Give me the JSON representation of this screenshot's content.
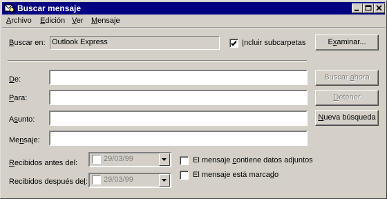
{
  "window": {
    "title": "Buscar mensaje"
  },
  "menu": [
    {
      "pre": "",
      "key": "A",
      "post": "rchivo"
    },
    {
      "pre": "",
      "key": "E",
      "post": "dición"
    },
    {
      "pre": "",
      "key": "V",
      "post": "er"
    },
    {
      "pre": "",
      "key": "M",
      "post": "ensaje"
    }
  ],
  "search_in": {
    "label_pre": "",
    "label_key": "B",
    "label_post": "uscar en:",
    "value": "Outlook Express",
    "subfolders": {
      "pre": "",
      "key": "I",
      "post": "ncluir subcarpetas",
      "checked": true
    },
    "browse": {
      "pre": "E",
      "key": "x",
      "post": "aminar..."
    }
  },
  "fields": {
    "from": {
      "pre": "",
      "key": "D",
      "post": "e:",
      "value": ""
    },
    "to": {
      "pre": "",
      "key": "P",
      "post": "ara:",
      "value": ""
    },
    "subject": {
      "pre": "A",
      "key": "s",
      "post": "unto:",
      "value": ""
    },
    "message": {
      "pre": "Me",
      "key": "n",
      "post": "saje:",
      "value": ""
    }
  },
  "buttons": {
    "find_now": {
      "pre": "Buscar ",
      "key": "a",
      "post": "hora",
      "enabled": false
    },
    "stop": {
      "pre": "",
      "key": "D",
      "post": "etener",
      "enabled": false
    },
    "new_search": {
      "pre": "",
      "key": "N",
      "post": "ueva búsqueda",
      "enabled": true
    }
  },
  "received_before": {
    "pre": "",
    "key": "R",
    "post": "ecibidos antes del:",
    "date": "29/03/99",
    "checked": false
  },
  "received_after": {
    "pre": "Recibidos después de",
    "key": "l",
    "post": ":",
    "date": "29/03/99",
    "checked": false
  },
  "options": {
    "attachments": {
      "pre": "El mensaje ",
      "key": "c",
      "post": "ontiene datos adjuntos",
      "checked": false
    },
    "flagged": {
      "pre": "El mensaje está marca",
      "key": "d",
      "post": "o",
      "checked": false
    }
  }
}
